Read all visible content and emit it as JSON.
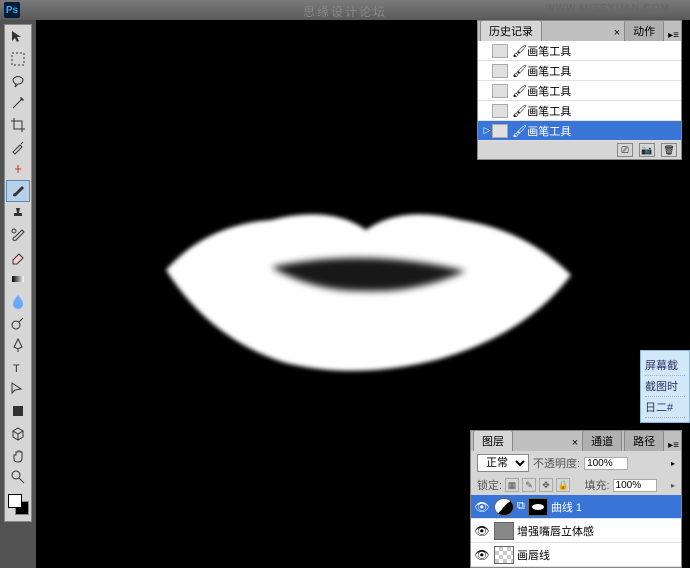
{
  "titlebar": {
    "app": "Ps"
  },
  "watermark": {
    "text": "思缘设计论坛",
    "url": "WWW.MISSYUAN.COM"
  },
  "history": {
    "tabs": [
      {
        "label": "历史记录",
        "active": true
      },
      {
        "label": "动作",
        "active": false
      }
    ],
    "items": [
      {
        "label": "画笔工具",
        "active": false
      },
      {
        "label": "画笔工具",
        "active": false
      },
      {
        "label": "画笔工具",
        "active": false
      },
      {
        "label": "画笔工具",
        "active": false
      },
      {
        "label": "画笔工具",
        "active": true
      }
    ]
  },
  "layers": {
    "tabs": [
      {
        "label": "图层",
        "active": true
      },
      {
        "label": "通道",
        "active": false
      },
      {
        "label": "路径",
        "active": false
      }
    ],
    "blend_mode": "正常",
    "opacity_label": "不透明度:",
    "opacity_value": "100%",
    "lock_label": "锁定:",
    "fill_label": "填充:",
    "fill_value": "100%",
    "rows": [
      {
        "name": "曲线 1",
        "visible": true,
        "active": true,
        "type": "adjustment"
      },
      {
        "name": "增强嘴唇立体感",
        "visible": true,
        "active": false,
        "type": "normal"
      },
      {
        "name": "画唇线",
        "visible": true,
        "active": false,
        "type": "checker"
      }
    ]
  },
  "tooltip": {
    "lines": [
      "屏幕截",
      "截图时",
      "日二#"
    ]
  }
}
